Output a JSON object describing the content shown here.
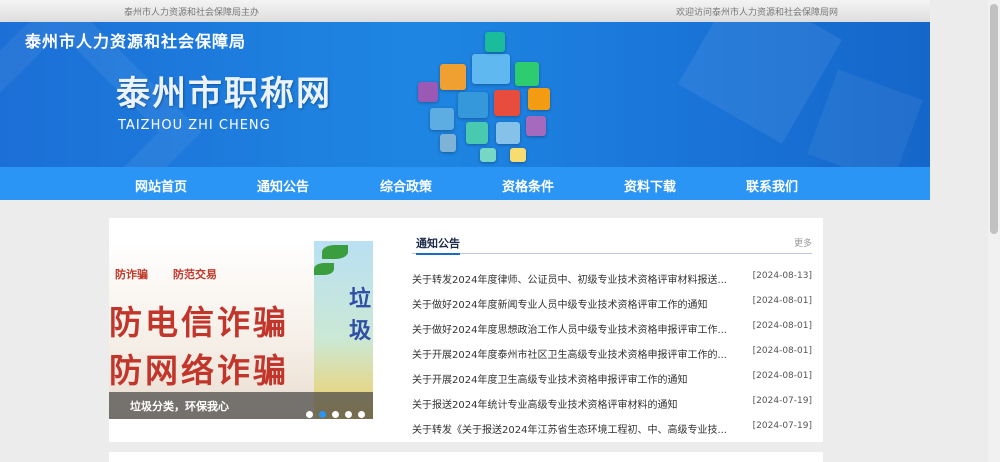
{
  "topbar": {
    "left_text": "泰州市人力资源和社会保障局主办",
    "right_text": "欢迎访问泰州市人力资源和社会保障局网"
  },
  "banner": {
    "bureau": "泰州市人力资源和社会保障局",
    "title": "泰州市职称网",
    "subtitle": "TAIZHOU ZHI CHENG"
  },
  "nav": [
    {
      "label": "网站首页"
    },
    {
      "label": "通知公告"
    },
    {
      "label": "综合政策"
    },
    {
      "label": "资格条件"
    },
    {
      "label": "资料下载"
    },
    {
      "label": "联系我们"
    }
  ],
  "slider": {
    "tag1": "防诈骗",
    "tag2": "防范交易",
    "line1": "防电信诈骗",
    "line2": "防网络诈骗",
    "side_text": "垃圾",
    "caption": "垃圾分类，环保我心",
    "active_dot": 2,
    "dot_count": 5
  },
  "news": {
    "title": "通知公告",
    "more": "更多",
    "items": [
      {
        "title": "关于转发2024年度律师、公证员中、初级专业技术资格评审材料报送...",
        "date": "[2024-08-13]"
      },
      {
        "title": "关于做好2024年度新闻专业人员中级专业技术资格评审工作的通知",
        "date": "[2024-08-01]"
      },
      {
        "title": "关于做好2024年度思想政治工作人员中级专业技术资格申报评审工作...",
        "date": "[2024-08-01]"
      },
      {
        "title": "关于开展2024年度泰州市社区卫生高级专业技术资格申报评审工作的...",
        "date": "[2024-08-01]"
      },
      {
        "title": "关于开展2024年度卫生高级专业技术资格申报评审工作的通知",
        "date": "[2024-08-01]"
      },
      {
        "title": "关于报送2024年统计专业高级专业技术资格评审材料的通知",
        "date": "[2024-07-19]"
      },
      {
        "title": "关于转发《关于报送2024年江苏省生态环境工程初、中、高级专业技...",
        "date": "[2024-07-19]"
      }
    ]
  },
  "colors": {
    "nav_bg": "#2b95f5",
    "banner_bg": "#1e86e2",
    "accent_red": "#c2352b"
  }
}
